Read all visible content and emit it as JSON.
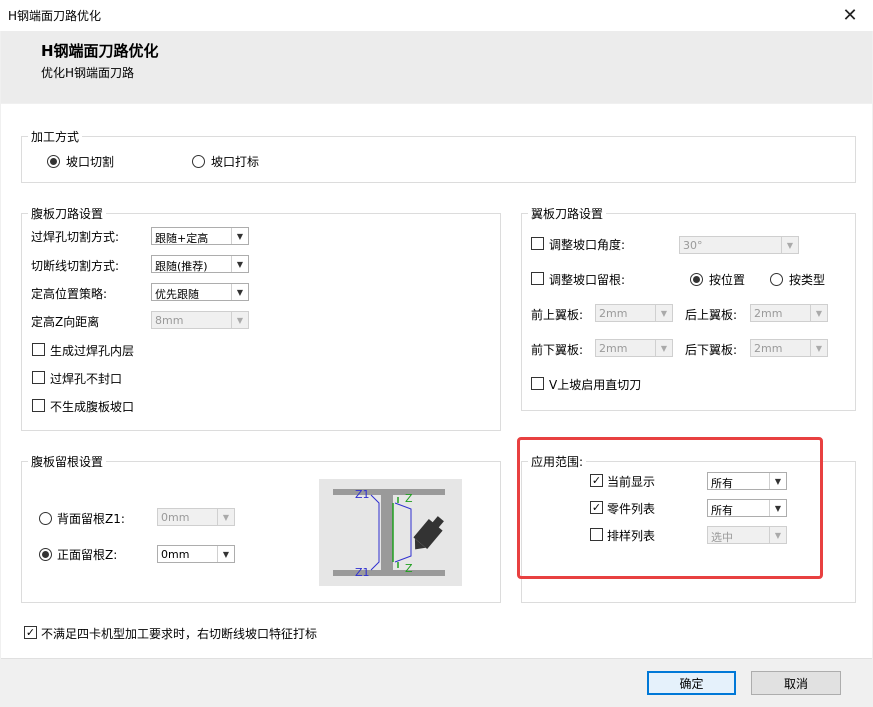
{
  "window": {
    "title": "H钢端面刀路优化",
    "close": "✕"
  },
  "header": {
    "title": "H钢端面刀路优化",
    "subtitle": "优化H钢端面刀路"
  },
  "processing": {
    "legend": "加工方式",
    "option1": "坡口切割",
    "option2": "坡口打标"
  },
  "web": {
    "legend": "腹板刀路设置",
    "weld_hole_label": "过焊孔切割方式:",
    "weld_hole_value": "跟随+定高",
    "cut_line_label": "切断线切割方式:",
    "cut_line_value": "跟随(推荐)",
    "height_policy_label": "定高位置策略:",
    "height_policy_value": "优先跟随",
    "z_dist_label": "定高Z向距离",
    "z_dist_value": "8mm",
    "chk1": "生成过焊孔内层",
    "chk2": "过焊孔不封口",
    "chk3": "不生成腹板坡口"
  },
  "flange": {
    "legend": "翼板刀路设置",
    "adjust_angle_label": "调整坡口角度:",
    "adjust_angle_value": "30°",
    "adjust_root_label": "调整坡口留根:",
    "by_position": "按位置",
    "by_type": "按类型",
    "front_upper_label": "前上翼板:",
    "front_upper_value": "2mm",
    "rear_upper_label": "后上翼板:",
    "rear_upper_value": "2mm",
    "front_lower_label": "前下翼板:",
    "front_lower_value": "2mm",
    "rear_lower_label": "后下翼板:",
    "rear_lower_value": "2mm",
    "v_label": "V上坡启用直切刀"
  },
  "root": {
    "legend": "腹板留根设置",
    "back_label": "背面留根Z1:",
    "back_value": "0mm",
    "front_label": "正面留根Z:",
    "front_value": "0mm",
    "diagram_z1": "Z1",
    "diagram_z": "Z"
  },
  "scope": {
    "legend": "应用范围:",
    "current_label": "当前显示",
    "current_value": "所有",
    "parts_label": "零件列表",
    "parts_value": "所有",
    "nest_label": "排样列表",
    "nest_value": "选中"
  },
  "bottom": {
    "chk_label": "不满足四卡机型加工要求时，右切断线坡口特征打标"
  },
  "buttons": {
    "ok": "确定",
    "cancel": "取消"
  },
  "colors": {
    "highlight": "#e84040",
    "accent": "#0078d7"
  }
}
